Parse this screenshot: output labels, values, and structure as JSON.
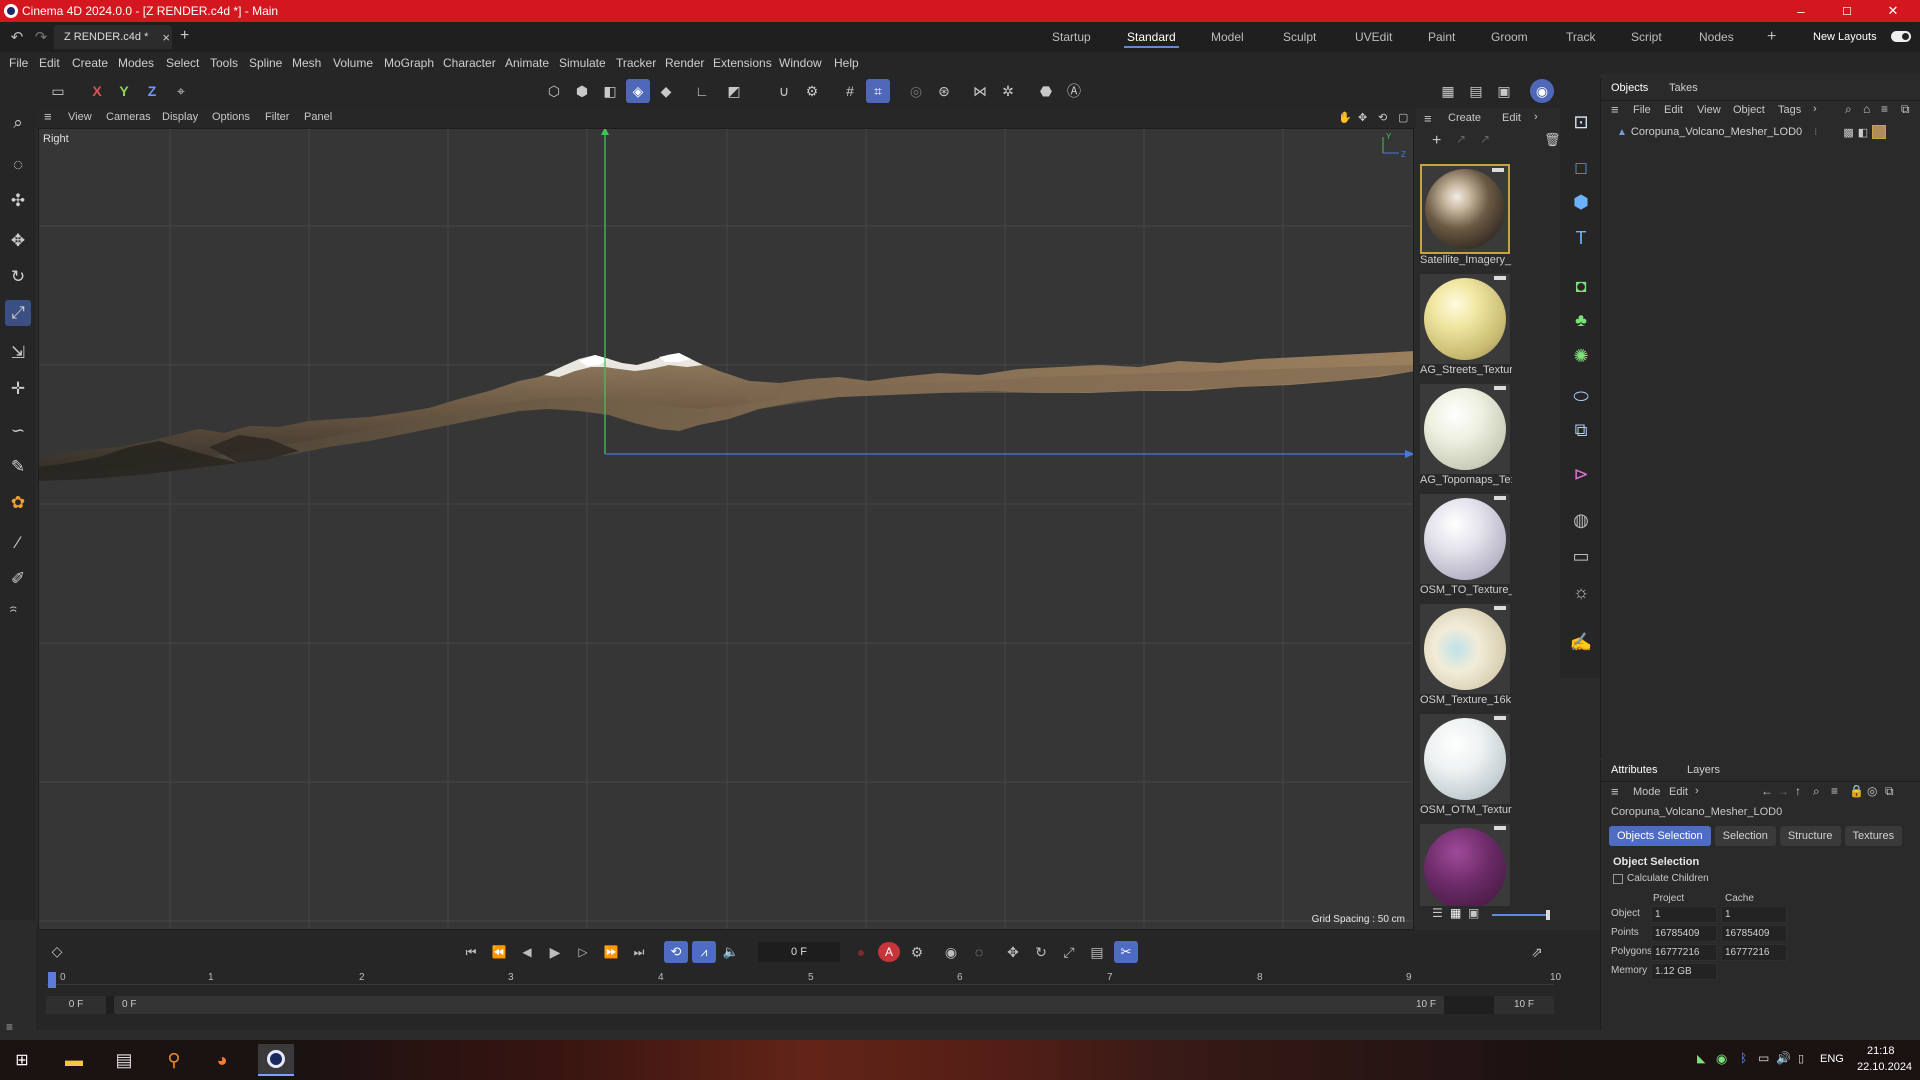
{
  "window": {
    "title": "Cinema 4D 2024.0.0 - [Z RENDER.c4d *] - Main",
    "minimize": "–",
    "maximize": "☐",
    "close": "✕"
  },
  "tabs": {
    "doc": "Z RENDER.c4d *",
    "close": "×",
    "add": "+"
  },
  "layouts": [
    "Startup",
    "Standard",
    "Model",
    "Sculpt",
    "UVEdit",
    "Paint",
    "Groom",
    "Track",
    "Script",
    "Nodes"
  ],
  "layout_active": "Standard",
  "layout_add": "+",
  "new_layouts": "New Layouts",
  "menu": [
    "File",
    "Edit",
    "Create",
    "Modes",
    "Select",
    "Tools",
    "Spline",
    "Mesh",
    "Volume",
    "MoGraph",
    "Character",
    "Animate",
    "Simulate",
    "Tracker",
    "Render",
    "Extensions",
    "Window",
    "Help"
  ],
  "axes": {
    "x": "X",
    "y": "Y",
    "z": "Z"
  },
  "viewport": {
    "menu": [
      "View",
      "Cameras",
      "Display",
      "Options",
      "Filter",
      "Panel"
    ],
    "name": "Right",
    "grid_spacing": "Grid Spacing : 50 cm"
  },
  "materials": {
    "menu": [
      "Create",
      "Edit"
    ],
    "items": [
      "Satellite_Imagery_",
      "AG_Streets_Textur",
      "AG_Topomaps_Te:",
      "OSM_TO_Texture_",
      "OSM_Texture_16k",
      "OSM_OTM_Textur",
      ""
    ]
  },
  "objects": {
    "tabs": [
      "Objects",
      "Takes"
    ],
    "menu": [
      "File",
      "Edit",
      "View",
      "Object",
      "Tags"
    ],
    "item": "Coropuna_Volcano_Mesher_LOD0"
  },
  "attributes": {
    "tabs": [
      "Attributes",
      "Layers"
    ],
    "menu": [
      "Mode",
      "Edit"
    ],
    "object_name": "Coropuna_Volcano_Mesher_LOD0",
    "subtabs": [
      "Objects Selection",
      "Selection",
      "Structure",
      "Textures"
    ],
    "section": "Object Selection",
    "checkbox": "Calculate Children",
    "col_project": "Project",
    "col_cache": "Cache",
    "rows": [
      {
        "label": "Object",
        "project": "1",
        "cache": "1"
      },
      {
        "label": "Points",
        "project": "16785409",
        "cache": "16785409"
      },
      {
        "label": "Polygons",
        "project": "16777216",
        "cache": "16777216"
      },
      {
        "label": "Memory",
        "project": "1.12 GB",
        "cache": ""
      }
    ]
  },
  "timeline": {
    "frame": "0 F",
    "ticks": [
      "0",
      "1",
      "2",
      "3",
      "4",
      "5",
      "6",
      "7",
      "8",
      "9",
      "10"
    ],
    "start": "0 F",
    "start2": "0 F",
    "end": "10 F",
    "end2": "10 F"
  },
  "taskbar": {
    "lang": "ENG",
    "time": "21:18",
    "date": "22.10.2024"
  },
  "colors": {
    "titlebar": "#d4161f",
    "accent": "#4e6cc4",
    "y_axis": "#3fc35a",
    "z_axis": "#4a78d8"
  }
}
